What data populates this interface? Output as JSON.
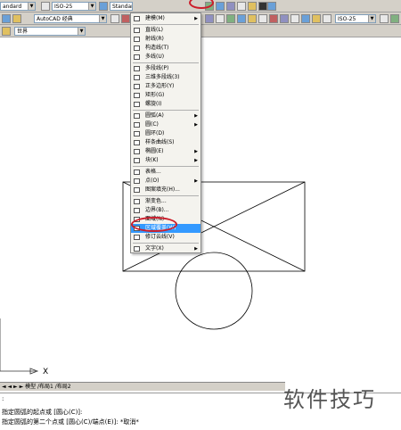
{
  "toolbar1": {
    "style_value": "andard",
    "dim_value": "ISO-25",
    "text_style": "Standar",
    "menu_label": "绘图(D)"
  },
  "toolbar2": {
    "workspace": "AutoCAD 经典",
    "dimstyle_right": "ISO-25"
  },
  "toolbar3": {
    "layer": "世界"
  },
  "menu": {
    "items": [
      {
        "label": "建模(M)",
        "sub": true
      },
      {
        "label": "直线(L)"
      },
      {
        "label": "射线(R)"
      },
      {
        "label": "构造线(T)"
      },
      {
        "label": "多线(U)"
      },
      {
        "label": "多段线(P)"
      },
      {
        "label": "三维多段线(3)"
      },
      {
        "label": "正多边形(Y)"
      },
      {
        "label": "矩形(G)"
      },
      {
        "label": "螺旋(I)"
      },
      {
        "label": "圆弧(A)",
        "sub": true
      },
      {
        "label": "圆(C)",
        "sub": true
      },
      {
        "label": "圆环(D)"
      },
      {
        "label": "样条曲线(S)"
      },
      {
        "label": "椭圆(E)",
        "sub": true
      },
      {
        "label": "块(K)",
        "sub": true
      },
      {
        "label": "表格..."
      },
      {
        "label": "点(O)",
        "sub": true
      },
      {
        "label": "图案填充(H)..."
      },
      {
        "label": "渐变色..."
      },
      {
        "label": "边界(B)..."
      },
      {
        "label": "面域(N)"
      },
      {
        "label": "区域覆盖(W)"
      },
      {
        "label": "修订云线(V)"
      },
      {
        "label": "文字(X)",
        "sub": true
      }
    ],
    "highlighted_index": 22,
    "highlight_color": "#3399ff",
    "annotation_color": "#cc1e2b"
  },
  "tabs": {
    "label": "模型 /布局1 /布局2"
  },
  "axis": {
    "x_label": "X"
  },
  "command": {
    "line1": ":",
    "line2": "指定圆弧的起点或 [圆心(C)]:",
    "line3": "指定圆弧的第二个点或 [圆心(C)/端点(E)]: *取消*"
  },
  "watermark": "软件技巧"
}
